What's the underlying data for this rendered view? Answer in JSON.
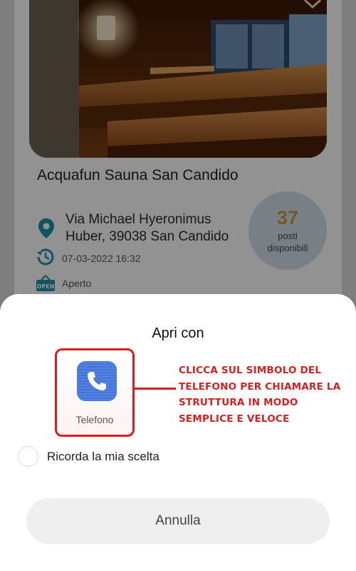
{
  "listing": {
    "name": "Acquafun Sauna San Candido",
    "address": "Via Michael Hyeronimus Huber,  39038 San Candido",
    "datetime": "07-03-2022 16:32",
    "status": "Aperto",
    "open_sign": "OPEN",
    "seats": {
      "count": "37",
      "label": "posti disponibili"
    },
    "image": "sauna-photo",
    "icons": [
      "location-pin-icon",
      "clock-icon",
      "open-sign-icon",
      "chevron-down-icon"
    ]
  },
  "sheet": {
    "title": "Apri con",
    "app": {
      "label": "Telefono",
      "icon": "phone-icon"
    },
    "annotation": "CLICCA SUL SIMBOLO DEL TELEFONO PER CHIAMARE LA STRUTTURA IN MODO SEMPLICE E VELOCE",
    "remember_label": "Ricorda la mia scelta",
    "remember_checked": false,
    "cancel_label": "Annulla"
  },
  "colors": {
    "accent_teal": "#1f8fa5",
    "seats_number": "#c89a36",
    "seats_badge_bg": "#cfdde6",
    "annotation_red": "#d71f1f",
    "phone_blue": "#3d6fd6"
  }
}
